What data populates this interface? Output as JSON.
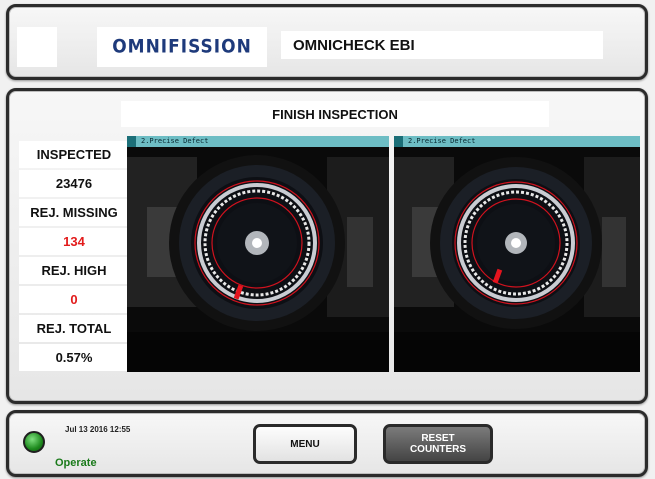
{
  "header": {
    "logo": "OMNIFISSION",
    "app_title": "OMNICHECK EBI"
  },
  "main": {
    "section_title": "FINISH INSPECTION",
    "counters": [
      {
        "label": "INSPECTED",
        "value": "23476"
      },
      {
        "label": "REJ. MISSING",
        "value": "134"
      },
      {
        "label": "REJ. HIGH",
        "value": "0"
      },
      {
        "label": "REJ. TOTAL",
        "value": "0.57%"
      }
    ],
    "cameras": [
      {
        "tag": "2.Precise Defect"
      },
      {
        "tag": "2.Precise Defect"
      }
    ]
  },
  "footer": {
    "datetime": "Jul 13 2016 12:55",
    "mode": "Operate",
    "menu_label": "MENU",
    "reset_label_line1": "RESET",
    "reset_label_line2": "COUNTERS"
  },
  "colors": {
    "accent_logo": "#1e3a7b",
    "reject_value": "#e21b1b",
    "status_ok": "#1a7a1a",
    "camera_tag": "#6dbdc4"
  }
}
